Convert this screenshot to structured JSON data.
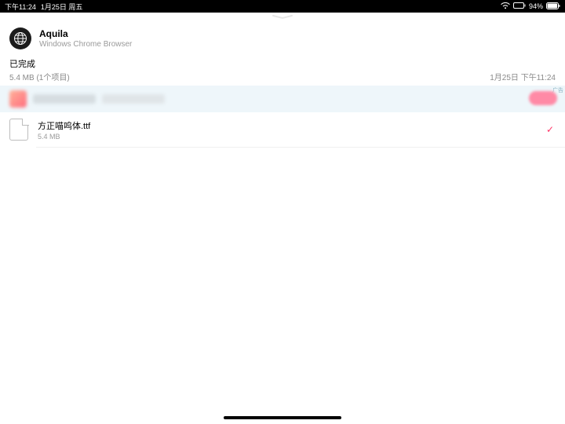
{
  "status": {
    "time": "下午11:24",
    "date": "1月25日 周五",
    "battery_pct": "94%"
  },
  "header": {
    "app_name": "Aquila",
    "app_sub": "Windows Chrome Browser"
  },
  "section": {
    "title": "已完成",
    "sub": "5.4 MB (1个项目)",
    "timestamp": "1月25日 下午11:24"
  },
  "ad": {
    "tag": "广告"
  },
  "file": {
    "name": "方正喵呜体.ttf",
    "size": "5.4 MB"
  }
}
